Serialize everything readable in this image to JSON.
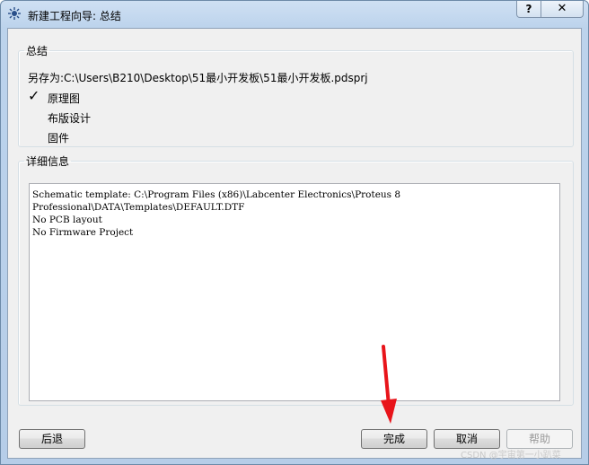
{
  "window": {
    "title": "新建工程向导: 总结",
    "help_label": "?",
    "close_label": "✕"
  },
  "summary": {
    "legend": "总结",
    "save_as": "另存为:C:\\Users\\B210\\Desktop\\51最小开发板\\51最小开发板.pdsprj",
    "items": [
      {
        "label": "原理图",
        "checked": true
      },
      {
        "label": "布版设计",
        "checked": false
      },
      {
        "label": "固件",
        "checked": false
      }
    ],
    "check_mark": "✓"
  },
  "details": {
    "legend": "详细信息",
    "lines": [
      "Schematic template: C:\\Program Files (x86)\\Labcenter Electronics\\Proteus 8",
      "Professional\\DATA\\Templates\\DEFAULT.DTF",
      "No PCB layout",
      "No Firmware Project"
    ]
  },
  "buttons": {
    "back": "后退",
    "finish": "完成",
    "cancel": "取消",
    "help": "帮助"
  },
  "watermark": "CSDN @宇宙第一小趴菜",
  "colors": {
    "arrow": "#e8141a"
  }
}
